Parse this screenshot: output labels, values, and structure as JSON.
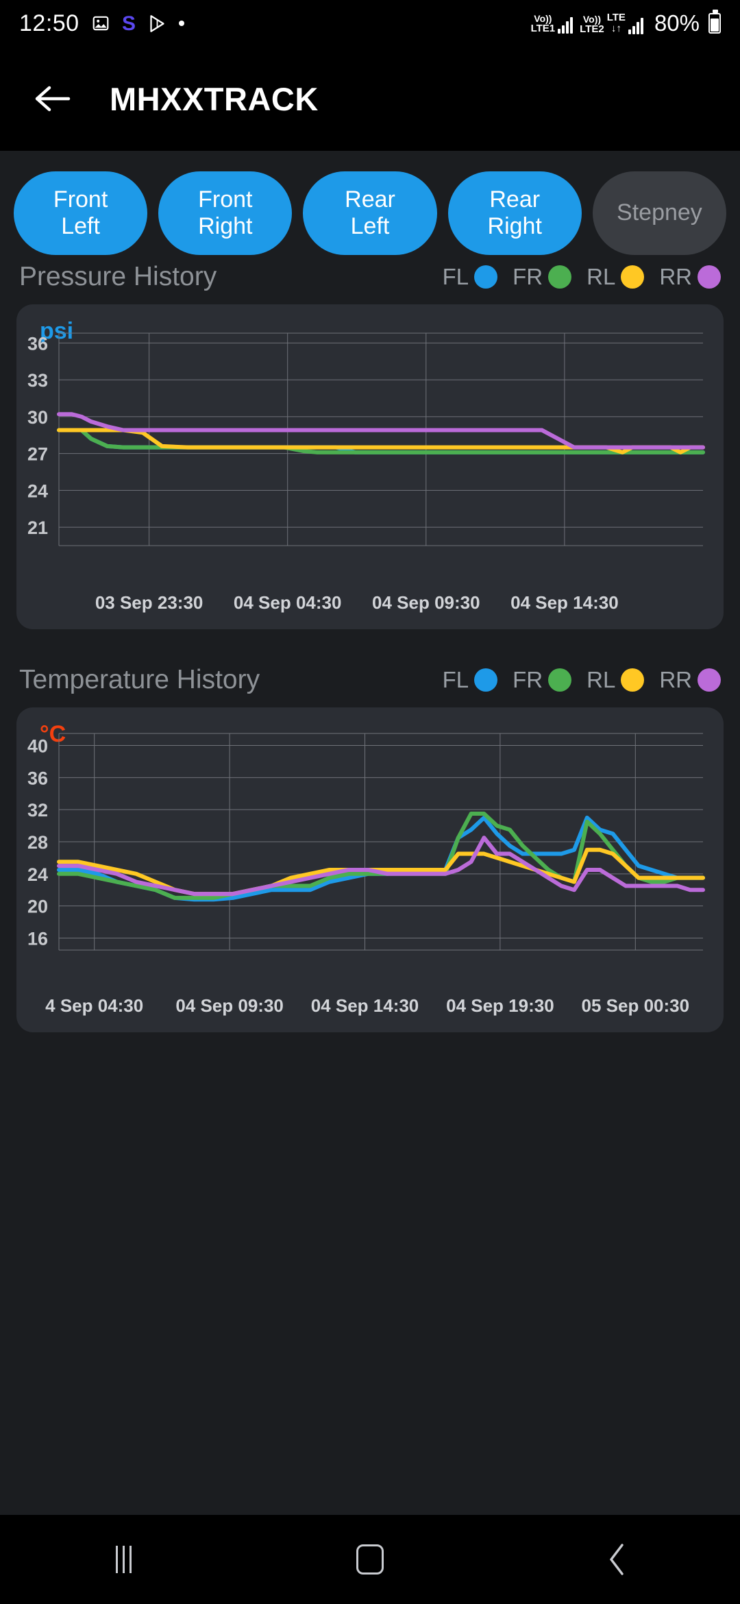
{
  "statusbar": {
    "clock": "12:50",
    "left_icons": [
      "photo-icon",
      "samsung-s-icon",
      "play-icon",
      "dot-icon"
    ],
    "sim1": {
      "volte": "Vo))",
      "label": "LTE1"
    },
    "sim2": {
      "volte": "Vo))",
      "label": "LTE2",
      "net": "LTE",
      "data": "↓↑"
    },
    "battery_percent": "80%"
  },
  "appbar": {
    "back_icon": "back-arrow-icon",
    "title": "MHXXTRACK"
  },
  "tires": [
    {
      "label_top": "Front",
      "label_bottom": "Left",
      "state": "active"
    },
    {
      "label_top": "Front",
      "label_bottom": "Right",
      "state": "active"
    },
    {
      "label_top": "Rear",
      "label_bottom": "Left",
      "state": "active"
    },
    {
      "label_top": "Rear",
      "label_bottom": "Right",
      "state": "active"
    },
    {
      "label_top": "Stepney",
      "label_bottom": "",
      "state": "disabled"
    }
  ],
  "legend": [
    {
      "label": "FL",
      "color": "#1e9ae8"
    },
    {
      "label": "FR",
      "color": "#4caf50"
    },
    {
      "label": "RL",
      "color": "#ffc824"
    },
    {
      "label": "RR",
      "color": "#bb6bd9"
    }
  ],
  "pressure_section": {
    "title": "Pressure History"
  },
  "temperature_section": {
    "title": "Temperature History"
  },
  "navbar": {
    "recents_label": "recents-icon",
    "home_label": "home-icon",
    "back_label": "back-icon"
  },
  "chart_data": [
    {
      "type": "line",
      "title": "Pressure History",
      "unit_label": "psi",
      "unit_color": "#1e9ae8",
      "ylabel": "psi",
      "xlabel": "",
      "ylim": [
        19.5,
        36.8
      ],
      "yticks": [
        36,
        33,
        30,
        27,
        24,
        21
      ],
      "grid": true,
      "legend_position": "top-right",
      "xticks": [
        "03 Sep 23:30",
        "04 Sep 04:30",
        "04 Sep 09:30",
        "04 Sep 14:30"
      ],
      "xtick_positions": [
        0.14,
        0.355,
        0.57,
        0.785
      ],
      "x": [
        0,
        0.02,
        0.035,
        0.05,
        0.075,
        0.1,
        0.13,
        0.16,
        0.2,
        0.25,
        0.3,
        0.33,
        0.35,
        0.38,
        0.4,
        0.43,
        0.46,
        0.5,
        0.55,
        0.6,
        0.65,
        0.7,
        0.75,
        0.8,
        0.85,
        0.875,
        0.89,
        0.91,
        0.93,
        0.95,
        0.965,
        0.98,
        1.0
      ],
      "series": [
        {
          "name": "FL",
          "color": "#1e9ae8",
          "values": [
            28.9,
            28.9,
            28.9,
            28.2,
            27.6,
            27.5,
            27.5,
            27.5,
            27.5,
            27.5,
            27.5,
            27.5,
            27.5,
            27.5,
            27.5,
            27.5,
            27.1,
            27.1,
            27.1,
            27.1,
            27.1,
            27.1,
            27.1,
            27.1,
            27.1,
            27.1,
            27.1,
            27.1,
            27.1,
            27.1,
            27.1,
            27.1,
            27.1
          ]
        },
        {
          "name": "FR",
          "color": "#4caf50",
          "values": [
            28.9,
            28.9,
            28.9,
            28.2,
            27.6,
            27.5,
            27.5,
            27.5,
            27.5,
            27.5,
            27.5,
            27.5,
            27.5,
            27.2,
            27.1,
            27.1,
            27.1,
            27.1,
            27.1,
            27.1,
            27.1,
            27.1,
            27.1,
            27.1,
            27.1,
            27.1,
            27.1,
            27.1,
            27.1,
            27.1,
            27.1,
            27.1,
            27.1
          ]
        },
        {
          "name": "RL",
          "color": "#ffc824",
          "values": [
            28.9,
            28.9,
            28.9,
            28.9,
            28.9,
            28.9,
            28.7,
            27.6,
            27.5,
            27.5,
            27.5,
            27.5,
            27.5,
            27.5,
            27.5,
            27.5,
            27.5,
            27.5,
            27.5,
            27.5,
            27.5,
            27.5,
            27.5,
            27.5,
            27.5,
            27.1,
            27.5,
            27.5,
            27.5,
            27.5,
            27.1,
            27.5,
            27.5
          ]
        },
        {
          "name": "RR",
          "color": "#bb6bd9",
          "values": [
            30.2,
            30.2,
            30.0,
            29.6,
            29.2,
            28.9,
            28.9,
            28.9,
            28.9,
            28.9,
            28.9,
            28.9,
            28.9,
            28.9,
            28.9,
            28.9,
            28.9,
            28.9,
            28.9,
            28.9,
            28.9,
            28.9,
            28.9,
            27.5,
            27.5,
            27.5,
            27.5,
            27.5,
            27.5,
            27.5,
            27.5,
            27.5,
            27.5
          ]
        }
      ]
    },
    {
      "type": "line",
      "title": "Temperature History",
      "unit_label": "°C",
      "unit_color": "#f4400f",
      "ylabel": "°C",
      "xlabel": "",
      "ylim": [
        14.5,
        41.5
      ],
      "yticks": [
        40,
        36,
        32,
        28,
        24,
        20,
        16
      ],
      "grid": true,
      "legend_position": "top-right",
      "xticks": [
        "4 Sep 04:30",
        "04 Sep 09:30",
        "04 Sep 14:30",
        "04 Sep 19:30",
        "05 Sep 00:30"
      ],
      "xtick_positions": [
        0.055,
        0.265,
        0.475,
        0.685,
        0.895
      ],
      "x": [
        0,
        0.03,
        0.06,
        0.09,
        0.12,
        0.15,
        0.18,
        0.21,
        0.24,
        0.27,
        0.3,
        0.33,
        0.36,
        0.39,
        0.42,
        0.45,
        0.48,
        0.51,
        0.54,
        0.57,
        0.6,
        0.62,
        0.64,
        0.66,
        0.68,
        0.7,
        0.72,
        0.74,
        0.76,
        0.78,
        0.8,
        0.82,
        0.84,
        0.86,
        0.88,
        0.9,
        0.92,
        0.94,
        0.96,
        0.98,
        1.0
      ],
      "series": [
        {
          "name": "FL",
          "color": "#1e9ae8",
          "values": [
            24.5,
            24.5,
            24.0,
            23.0,
            22.5,
            22.0,
            21.0,
            20.8,
            20.8,
            21.0,
            21.5,
            22.0,
            22.0,
            22.0,
            23.0,
            23.5,
            24.0,
            24.0,
            24.5,
            24.5,
            24.5,
            28.5,
            29.5,
            31.0,
            29.0,
            27.5,
            26.5,
            26.5,
            26.5,
            26.5,
            27.0,
            31.0,
            29.5,
            29.0,
            27.0,
            25.0,
            24.5,
            24.0,
            23.5,
            23.5,
            23.5
          ]
        },
        {
          "name": "FR",
          "color": "#4caf50",
          "values": [
            24.0,
            24.0,
            23.5,
            23.0,
            22.5,
            22.0,
            21.0,
            21.0,
            21.0,
            21.5,
            22.0,
            22.5,
            22.5,
            22.5,
            23.5,
            24.0,
            24.0,
            24.0,
            24.0,
            24.0,
            24.0,
            28.5,
            31.5,
            31.5,
            30.0,
            29.5,
            27.5,
            26.0,
            24.5,
            23.5,
            23.0,
            30.5,
            29.0,
            27.0,
            25.0,
            23.5,
            23.0,
            23.0,
            23.5,
            23.5,
            23.5
          ]
        },
        {
          "name": "RL",
          "color": "#ffc824",
          "values": [
            25.5,
            25.5,
            25.0,
            24.5,
            24.0,
            23.0,
            22.0,
            21.5,
            21.5,
            21.5,
            22.0,
            22.5,
            23.5,
            24.0,
            24.5,
            24.5,
            24.5,
            24.5,
            24.5,
            24.5,
            24.5,
            26.5,
            26.5,
            26.5,
            26.0,
            25.5,
            25.0,
            24.5,
            24.0,
            23.5,
            23.0,
            27.0,
            27.0,
            26.5,
            25.0,
            23.5,
            23.5,
            23.5,
            23.5,
            23.5,
            23.5
          ]
        },
        {
          "name": "RR",
          "color": "#bb6bd9",
          "values": [
            25.0,
            25.0,
            24.5,
            24.0,
            23.0,
            22.5,
            22.0,
            21.5,
            21.5,
            21.5,
            22.0,
            22.5,
            23.0,
            23.5,
            24.0,
            24.5,
            24.5,
            24.0,
            24.0,
            24.0,
            24.0,
            24.5,
            25.5,
            28.5,
            26.5,
            26.5,
            25.5,
            24.5,
            23.5,
            22.5,
            22.0,
            24.5,
            24.5,
            23.5,
            22.5,
            22.5,
            22.5,
            22.5,
            22.5,
            22.0,
            22.0
          ]
        }
      ]
    }
  ]
}
